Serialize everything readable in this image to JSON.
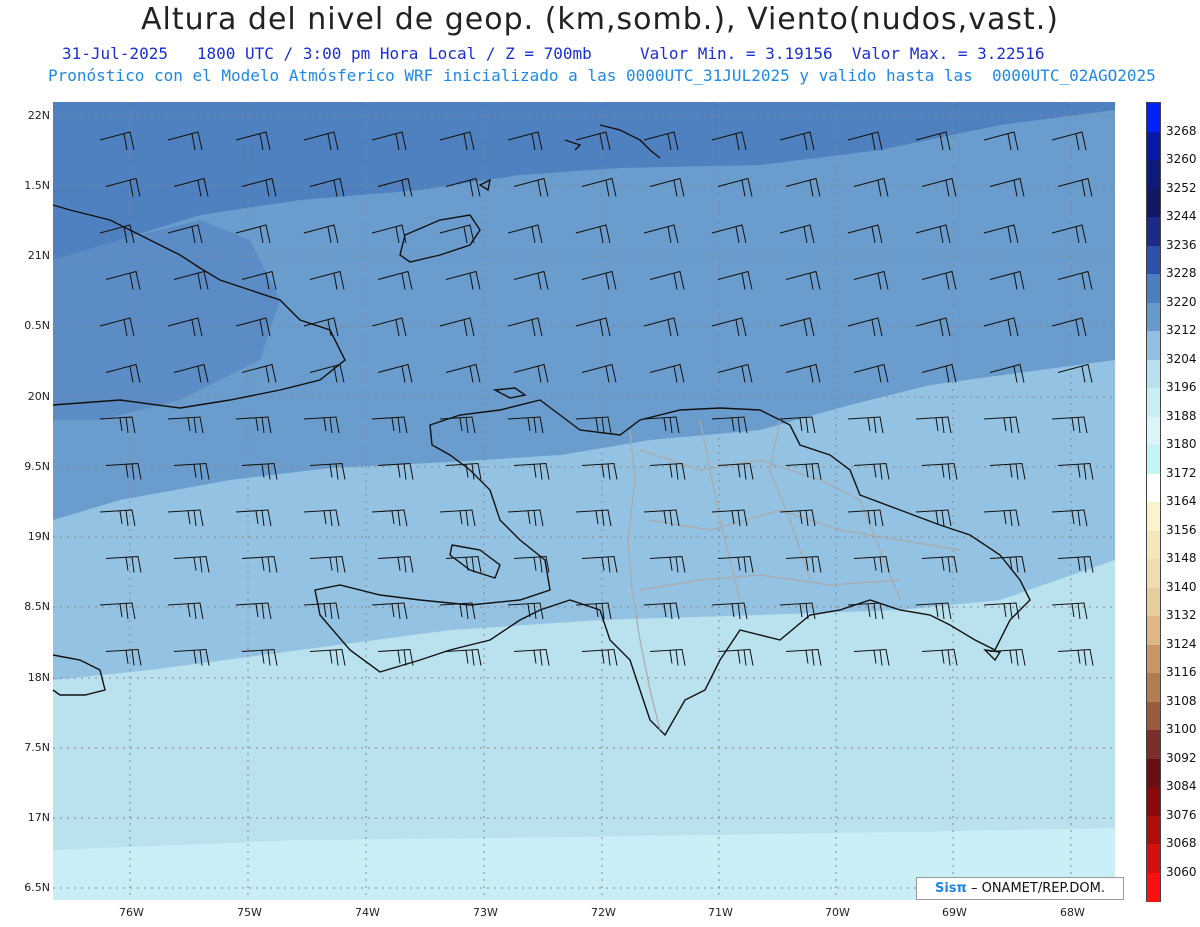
{
  "title": "Altura del nivel de geop. (km,somb.), Viento(nudos,vast.)",
  "subtitle_line1": "31-Jul-2025   1800 UTC / 3:00 pm Hora Local / Z = 700mb     Valor Min. = 3.19156  Valor Max. = 3.22516",
  "subtitle_line2": "Pronóstico con el Modelo Atmósferico WRF inicializado a las 0000UTC_31JUL2025 y valido hasta las  0000UTC_02AGO2025",
  "lat_labels": [
    "22N",
    "1.5N",
    "21N",
    "0.5N",
    "20N",
    "9.5N",
    "19N",
    "8.5N",
    "18N",
    "7.5N",
    "17N",
    "6.5N"
  ],
  "lon_labels": [
    "76W",
    "75W",
    "74W",
    "73W",
    "72W",
    "71W",
    "70W",
    "69W",
    "68W"
  ],
  "colorbar": {
    "labels": [
      "3268",
      "3260",
      "3252",
      "3244",
      "3236",
      "3228",
      "3220",
      "3212",
      "3204",
      "3196",
      "3188",
      "3180",
      "3172",
      "3164",
      "3156",
      "3148",
      "3140",
      "3132",
      "3124",
      "3116",
      "3108",
      "3100",
      "3092",
      "3084",
      "3076",
      "3068",
      "3060"
    ],
    "colors": [
      "#0022ff",
      "#0a1aa8",
      "#0e1a7d",
      "#131866",
      "#1e2a88",
      "#2e4faa",
      "#4b7fc2",
      "#6699cc",
      "#94bfe0",
      "#b7e1ee",
      "#c9eef4",
      "#dcf5f9",
      "#c6f3f6",
      "#ffffff",
      "#fbf3cc",
      "#f5e6be",
      "#efdcb0",
      "#e7cc9e",
      "#ddb887",
      "#c99664",
      "#b37d52",
      "#9c5a3c",
      "#7c2e2c",
      "#6a0f14",
      "#8a0a0a",
      "#b20d0d",
      "#d60f0f",
      "#ff1010"
    ]
  },
  "credit": {
    "logo": "Sisπ",
    "text": "–  ONAMET/REP.DOM."
  },
  "colors": {
    "band_dark": "#4f80bf",
    "band_mid": "#6a9ccd",
    "band_light": "#93c2e2",
    "band_pale": "#b9e2ee",
    "band_palest": "#c9eef5"
  }
}
